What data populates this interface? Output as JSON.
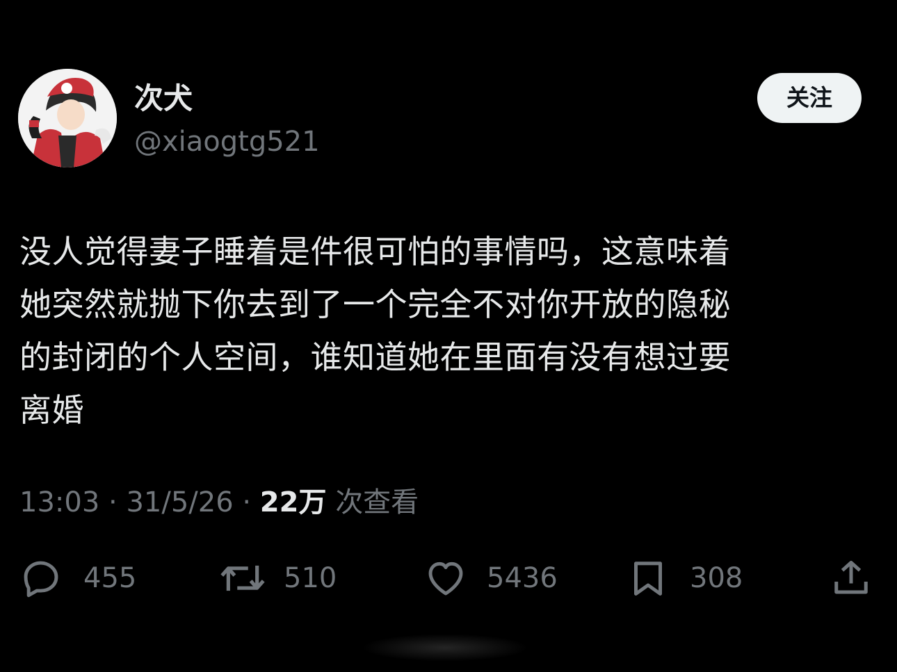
{
  "user": {
    "display_name": "次犬",
    "handle": "@xiaogtg521",
    "avatar_icon": "anime-character-avatar"
  },
  "follow_button_label": "关注",
  "tweet": {
    "lines": [
      "没人觉得妻子睡着是件很可怕的事情吗，这意味着",
      "她突然就抛下你去到了一个完全不对你开放的隐秘",
      "的封闭的个人空间，谁知道她在里面有没有想过要",
      "离婚"
    ]
  },
  "meta": {
    "time": "13:03",
    "separator": "·",
    "date": "31/5/26",
    "views_count": "22万",
    "views_label": "次查看"
  },
  "actions": {
    "reply": {
      "icon": "reply-icon",
      "count": "455"
    },
    "retweet": {
      "icon": "retweet-icon",
      "count": "510"
    },
    "like": {
      "icon": "heart-icon",
      "count": "5436"
    },
    "bookmark": {
      "icon": "bookmark-icon",
      "count": "308"
    },
    "share": {
      "icon": "share-icon"
    }
  },
  "colors": {
    "background": "#000000",
    "text_primary": "#e7e9ea",
    "text_secondary": "#71767b",
    "follow_bg": "#eff3f4",
    "follow_text": "#0f1419"
  }
}
